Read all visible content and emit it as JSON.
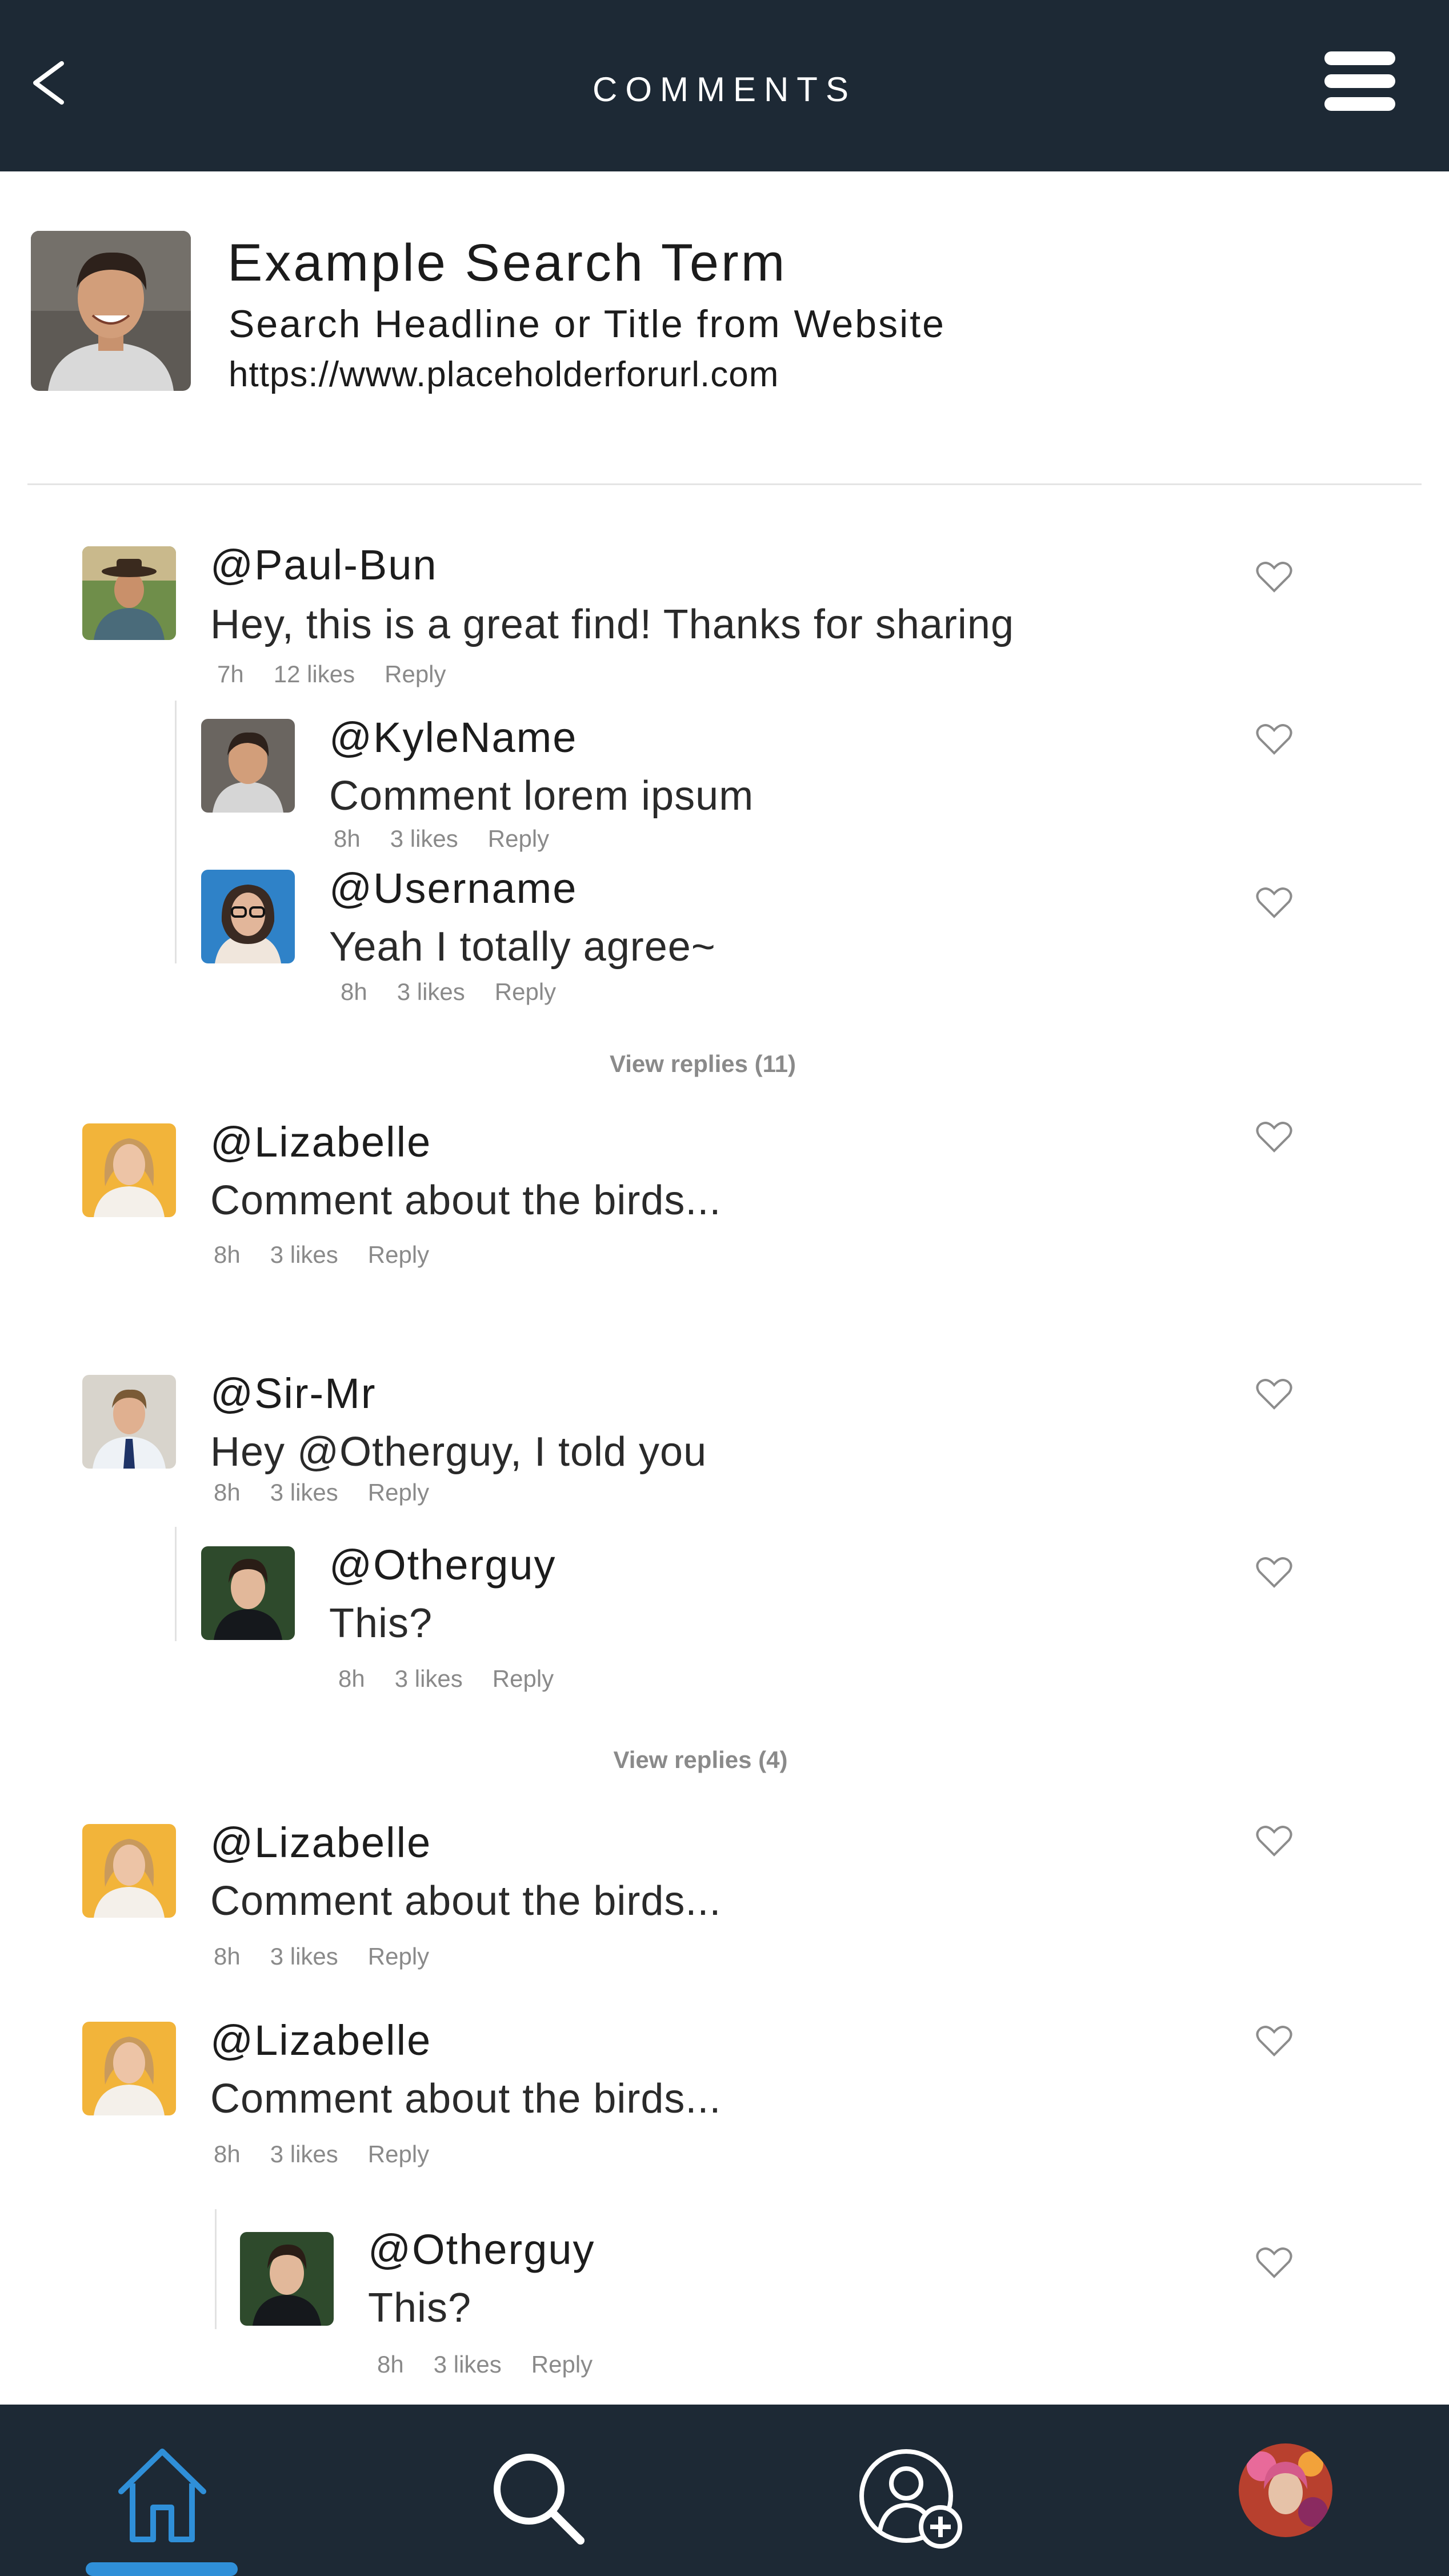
{
  "header": {
    "title": "COMMENTS",
    "back_icon": "chevron-left-icon",
    "menu_icon": "hamburger-menu-icon"
  },
  "result": {
    "term": "Example Search Term",
    "headline": "Search Headline or Title from Website",
    "url": "https://www.placeholderforurl.com"
  },
  "comments": [
    {
      "user": "@Paul-Bun",
      "text": "Hey, this is a great find! Thanks for sharing",
      "time": "7h",
      "likes": "12 likes",
      "reply": "Reply"
    },
    {
      "user": "@KyleName",
      "text": "Comment lorem ipsum",
      "time": "8h",
      "likes": "3 likes",
      "reply": "Reply"
    },
    {
      "user": "@Username",
      "text": "Yeah I totally agree~",
      "time": "8h",
      "likes": "3 likes",
      "reply": "Reply"
    },
    {
      "user": "@Lizabelle",
      "text": "Comment about the birds...",
      "time": "8h",
      "likes": "3 likes",
      "reply": "Reply"
    },
    {
      "user": "@Sir-Mr",
      "text": "Hey @Otherguy, I told you",
      "time": "8h",
      "likes": "3 likes",
      "reply": "Reply"
    },
    {
      "user": "@Otherguy",
      "text": "This?",
      "time": "8h",
      "likes": "3 likes",
      "reply": "Reply"
    },
    {
      "user": "@Lizabelle",
      "text": "Comment about the birds...",
      "time": "8h",
      "likes": "3 likes",
      "reply": "Reply"
    },
    {
      "user": "@Lizabelle",
      "text": "Comment about the birds...",
      "time": "8h",
      "likes": "3 likes",
      "reply": "Reply"
    },
    {
      "user": "@Otherguy",
      "text": "This?",
      "time": "8h",
      "likes": "3 likes",
      "reply": "Reply"
    }
  ],
  "view_replies": [
    "View replies (11)",
    "View replies (4)"
  ],
  "nav": {
    "items": [
      "home-icon",
      "search-icon",
      "add-friend-icon",
      "profile-avatar"
    ],
    "active_color": "#2f8fd8"
  },
  "colors": {
    "header_bg": "#1d2935",
    "accent": "#2f8fd8",
    "meta_text": "#8a8a8a"
  }
}
